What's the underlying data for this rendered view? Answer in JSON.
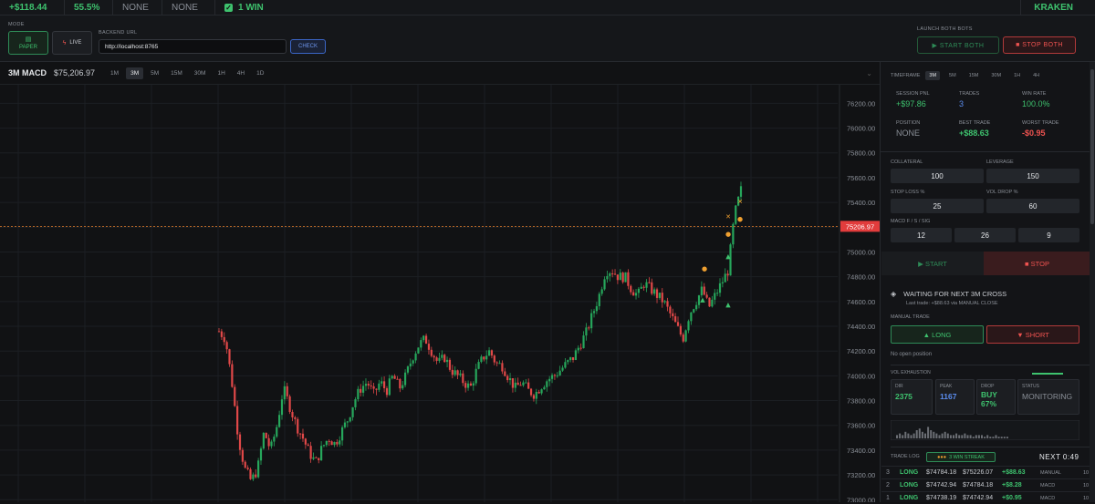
{
  "topbar": {
    "pnl": "+$118.44",
    "winrate": "55.5%",
    "pos1": "NONE",
    "pos2": "NONE",
    "wins": "1 WIN",
    "exchange": "KRAKEN"
  },
  "mode": {
    "label": "MODE",
    "paper": "PAPER",
    "live": "LIVE",
    "url_label": "BACKEND URL",
    "url": "http://localhost:8765",
    "check": "CHECK",
    "launch_label": "LAUNCH BOTH BOTS",
    "start_both": "▶ START BOTH",
    "stop_both": "■ STOP BOTH"
  },
  "chart_head": {
    "title": "3M MACD",
    "price": "$75,206.97",
    "timeframes": [
      "1M",
      "3M",
      "5M",
      "15M",
      "30M",
      "1H",
      "4H",
      "1D"
    ],
    "active": "3M",
    "more": "⌄"
  },
  "chart_data": {
    "type": "candlestick",
    "last_price": 75206.97,
    "last_price_label": "75206.97",
    "ylim": [
      72980,
      76350
    ],
    "y_ticks": [
      73000,
      73200,
      73400,
      73600,
      73800,
      74000,
      74200,
      74400,
      74600,
      74800,
      75000,
      75200,
      75400,
      75600,
      75800,
      76000,
      76200
    ],
    "y_tick_labels": [
      "73000.00",
      "73200.00",
      "73400.00",
      "73600.00",
      "73800.00",
      "74000.00",
      "74200.00",
      "74400.00",
      "74600.00",
      "74800.00",
      "75000.00",
      "75200.00",
      "75400.00",
      "75600.00",
      "75800.00",
      "76000.00",
      "76200.00"
    ],
    "path": [
      74360,
      74300,
      73950,
      73500,
      73250,
      73150,
      73250,
      73550,
      73400,
      73600,
      73900,
      73750,
      73600,
      73500,
      73380,
      73300,
      73420,
      73500,
      73450,
      73550,
      73650,
      73800,
      73900,
      73950,
      73850,
      73950,
      73880,
      74000,
      73900,
      74000,
      74150,
      74250,
      74300,
      74200,
      74100,
      74150,
      74050,
      74000,
      73950,
      73900,
      74050,
      74150,
      74200,
      74100,
      74080,
      73980,
      73900,
      73950,
      73880,
      73850,
      73920,
      73970,
      74000,
      74050,
      74100,
      74150,
      74250,
      74350,
      74500,
      74650,
      74850,
      74850,
      74800,
      74800,
      74700,
      74650,
      74750,
      74700,
      74650,
      74600,
      74500,
      74400,
      74300,
      74500,
      74600,
      74700,
      74550,
      74650,
      74750,
      74850,
      75300,
      75500
    ]
  },
  "right": {
    "tf_label": "TIMEFRAME",
    "tfs": [
      "3M",
      "5M",
      "15M",
      "30M",
      "1H",
      "4H"
    ],
    "stats": [
      {
        "label": "SESSION PNL",
        "value": "+$97.86",
        "color": "green"
      },
      {
        "label": "TRADES",
        "value": "3",
        "color": "blue"
      },
      {
        "label": "WIN RATE",
        "value": "100.0%",
        "color": "green"
      },
      {
        "label": "POSITION",
        "value": "NONE",
        "color": "gray"
      },
      {
        "label": "BEST TRADE",
        "value": "+$88.63",
        "color": "green"
      },
      {
        "label": "WORST TRADE",
        "value": "-$0.95",
        "color": "red"
      }
    ],
    "cfg": {
      "collateral_l": "COLLATERAL",
      "collateral": "100",
      "leverage_l": "LEVERAGE",
      "leverage": "150",
      "sl_l": "STOP LOSS %",
      "sl": "25",
      "vd_l": "VOL DROP %",
      "vd": "60",
      "macd_l": "MACD F / S / SIG",
      "f": "12",
      "s": "26",
      "sig": "9"
    },
    "bot": {
      "start": "▶ START",
      "stop": "■ STOP"
    },
    "waiting": "WAITING FOR NEXT 3M CROSS",
    "waiting_sub": "Last trade: +$88.63 via MANUAL CLOSE",
    "manual_label": "MANUAL TRADE",
    "long": "▲ LONG",
    "short": "▼ SHORT",
    "no_pos": "No open position",
    "vol_label": "VOL EXHAUSTION",
    "vol": [
      {
        "l": "DIR",
        "v": "2375",
        "c": "green"
      },
      {
        "l": "PEAK",
        "v": "1167",
        "c": "blue"
      },
      {
        "l": "DROP",
        "v": "BUY\n67%",
        "c": "green"
      },
      {
        "l": "STATUS",
        "v": "MONITORING",
        "c": "gray"
      }
    ],
    "trade_log_label": "TRADE LOG",
    "streak": "3 WIN STREAK",
    "next": "NEXT 0:49",
    "trades": [
      {
        "n": "3",
        "side": "LONG",
        "entry": "$74784.18",
        "exit": "$75226.07",
        "pnl": "+$88.63",
        "src": "MANUAL",
        "t": "10"
      },
      {
        "n": "2",
        "side": "LONG",
        "entry": "$74742.94",
        "exit": "$74784.18",
        "pnl": "+$8.28",
        "src": "MACD",
        "t": "10"
      },
      {
        "n": "1",
        "side": "LONG",
        "entry": "$74738.19",
        "exit": "$74742.94",
        "pnl": "+$0.95",
        "src": "MACD",
        "t": "10"
      }
    ]
  },
  "colors": {
    "green": "#3ec26e",
    "red": "#ef5350",
    "blue": "#5b8def",
    "bg": "#111214"
  }
}
